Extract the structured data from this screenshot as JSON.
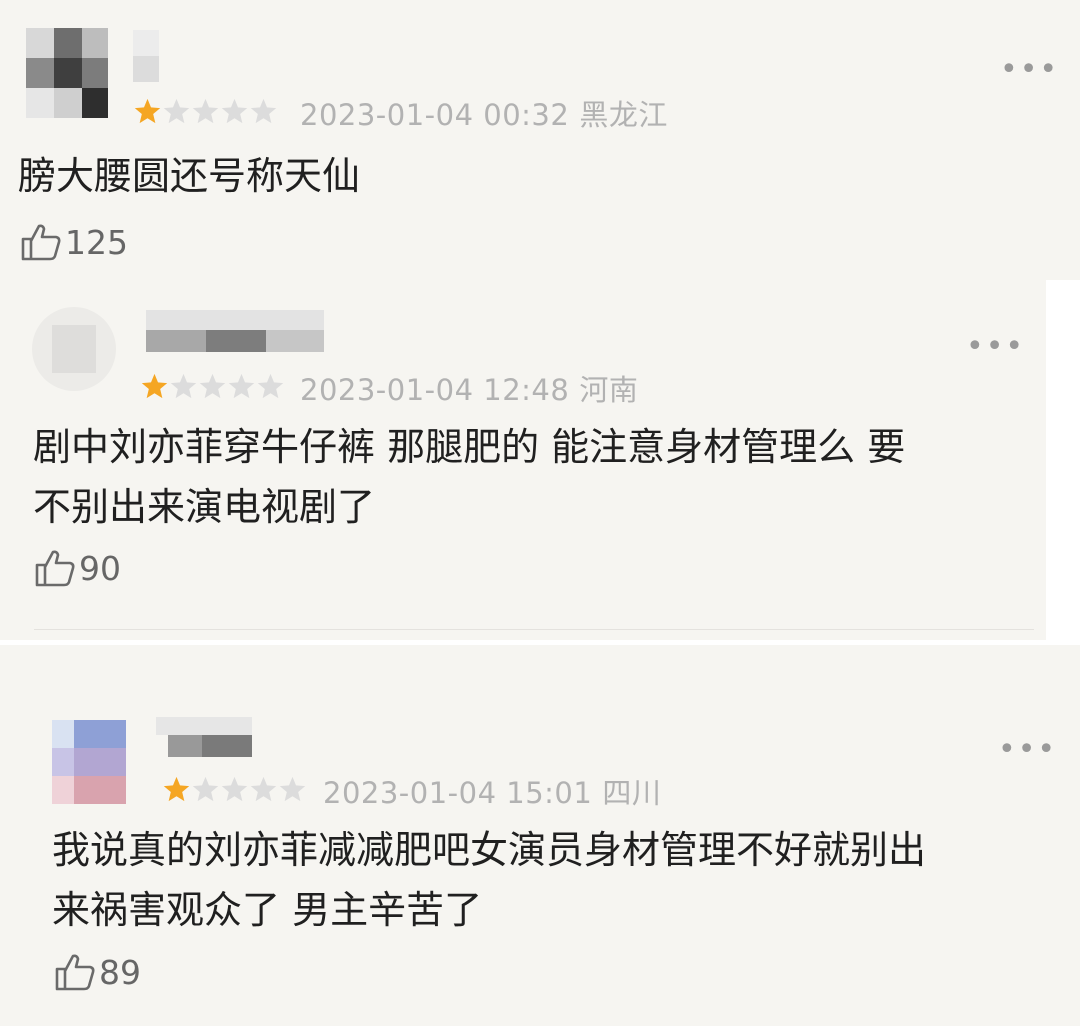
{
  "colors": {
    "background": "#f6f5f1",
    "star_filled": "#f5a623",
    "star_empty": "#dcdcdc",
    "meta_text": "#b2b2b2"
  },
  "comments": [
    {
      "rating": 1,
      "date": "2023-01-04 00:32",
      "location": "黑龙江",
      "content": "膀大腰圆还号称天仙",
      "likes": "125",
      "more_icon": "more-dots-icon",
      "like_icon": "thumbs-up-icon"
    },
    {
      "rating": 1,
      "date": "2023-01-04 12:48",
      "location": "河南",
      "content": "剧中刘亦菲穿牛仔裤 那腿肥的 能注意身材管理么 要\n不别出来演电视剧了",
      "likes": "90",
      "more_icon": "more-dots-icon",
      "like_icon": "thumbs-up-icon"
    },
    {
      "rating": 1,
      "date": "2023-01-04 15:01",
      "location": "四川",
      "content": "我说真的刘亦菲减减肥吧女演员身材管理不好就别出\n来祸害观众了 男主辛苦了",
      "likes": "89",
      "more_icon": "more-dots-icon",
      "like_icon": "thumbs-up-icon"
    }
  ]
}
